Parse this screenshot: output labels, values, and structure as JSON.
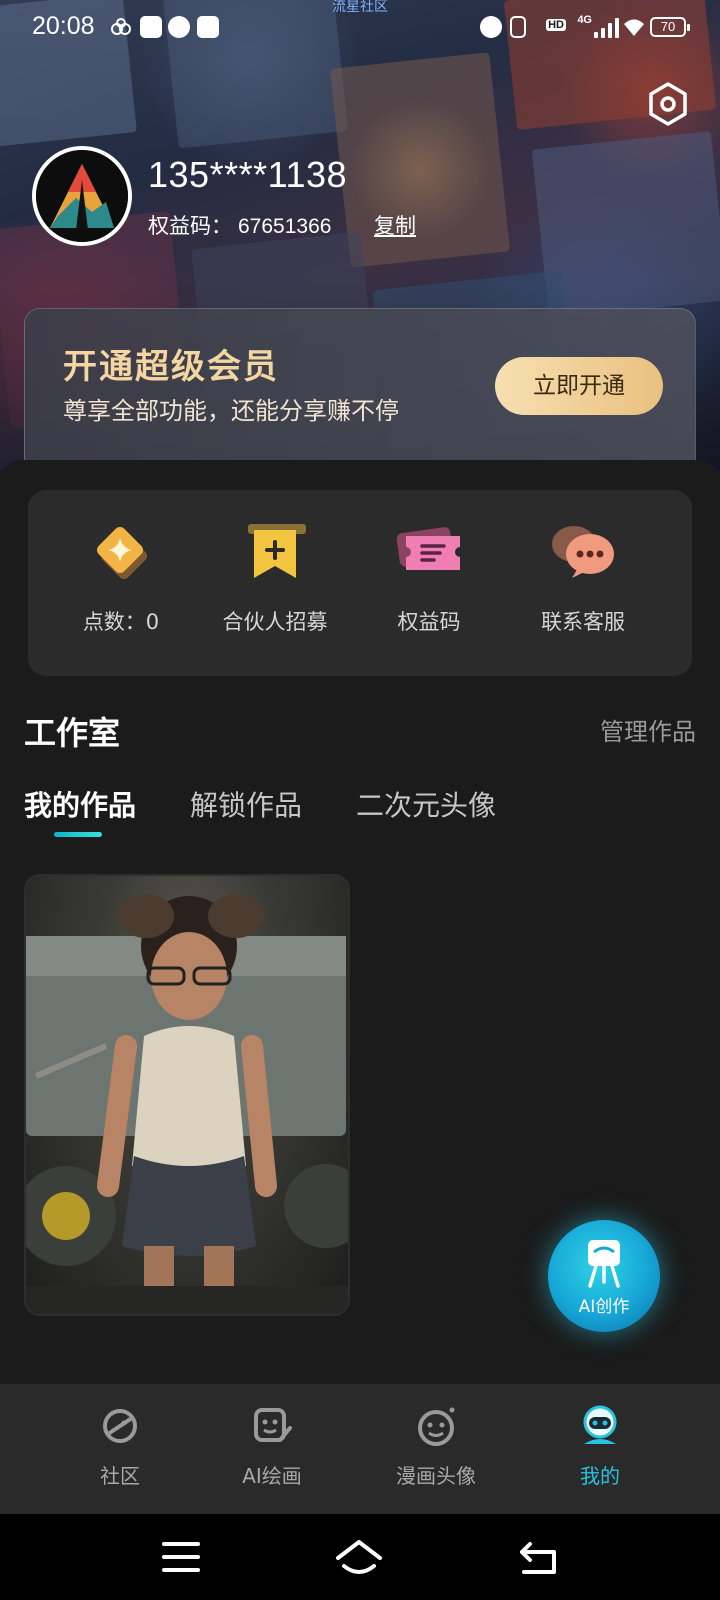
{
  "status_bar": {
    "time": "20:08",
    "app_name": "流星社区",
    "hd_label": "HD",
    "network_label": "4G",
    "battery_level": "70"
  },
  "profile": {
    "phone": "135****1138",
    "code_label": "权益码：",
    "code_value": "67651366",
    "copy_label": "复制"
  },
  "vip": {
    "title": "开通超级会员",
    "subtitle": "尊享全部功能，还能分享赚不停",
    "button": "立即开通"
  },
  "quick_actions": [
    {
      "label": "点数：0",
      "icon": "diamond-icon"
    },
    {
      "label": "合伙人招募",
      "icon": "bookmark-plus-icon"
    },
    {
      "label": "权益码",
      "icon": "ticket-icon"
    },
    {
      "label": "联系客服",
      "icon": "chat-bubbles-icon"
    }
  ],
  "studio": {
    "title": "工作室",
    "manage": "管理作品",
    "tabs": [
      "我的作品",
      "解锁作品",
      "二次元头像"
    ],
    "active_tab": 0
  },
  "fab": {
    "label": "AI创作"
  },
  "bottom_nav": [
    {
      "label": "社区",
      "icon": "planet-icon"
    },
    {
      "label": "AI绘画",
      "icon": "ai-paint-icon"
    },
    {
      "label": "漫画头像",
      "icon": "smile-face-icon"
    },
    {
      "label": "我的",
      "icon": "robot-profile-icon",
      "active": true
    }
  ],
  "colors": {
    "accent": "#27c2e0",
    "vip_gold": "#f4d6a3",
    "background": "#1b1b1b"
  }
}
